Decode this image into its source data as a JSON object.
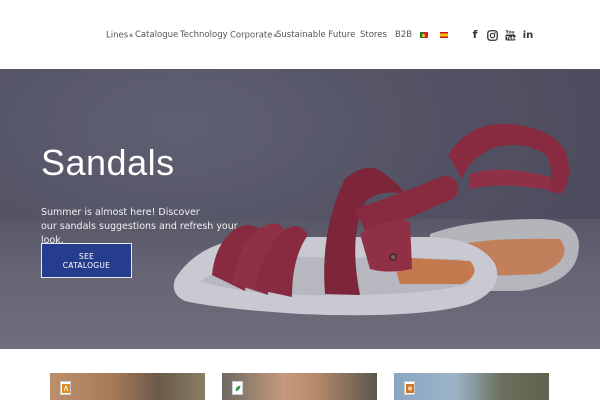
{
  "nav": {
    "items": [
      {
        "label": "Lines",
        "has_dropdown": true
      },
      {
        "label": "Catalogue",
        "has_dropdown": false
      },
      {
        "label": "Technology",
        "has_dropdown": false
      },
      {
        "label": "Corporate",
        "has_dropdown": true
      },
      {
        "label": "Sustainable Future",
        "has_dropdown": false
      },
      {
        "label": "Stores",
        "has_dropdown": false
      },
      {
        "label": "B2B",
        "has_dropdown": false
      }
    ],
    "languages": [
      "flag-portugal-icon",
      "flag-spain-icon"
    ],
    "social": [
      "facebook-icon",
      "instagram-icon",
      "youtube-icon",
      "linkedin-icon"
    ]
  },
  "hero": {
    "title": "Sandals",
    "text_line1": "Summer is almost here! Discover",
    "text_line2": "our sandals suggestions and refresh your look.",
    "button_line1": "SEE",
    "button_line2": "CATALOGUE"
  },
  "teasers": [
    {
      "badge_icon": "line-badge-icon"
    },
    {
      "badge_icon": "leaf-badge-icon"
    },
    {
      "badge_icon": "pattern-badge-icon"
    }
  ],
  "colors": {
    "button_bg": "#263c8c",
    "sandal_red": "#9a2c40",
    "sole_orange": "#e07a3a"
  }
}
